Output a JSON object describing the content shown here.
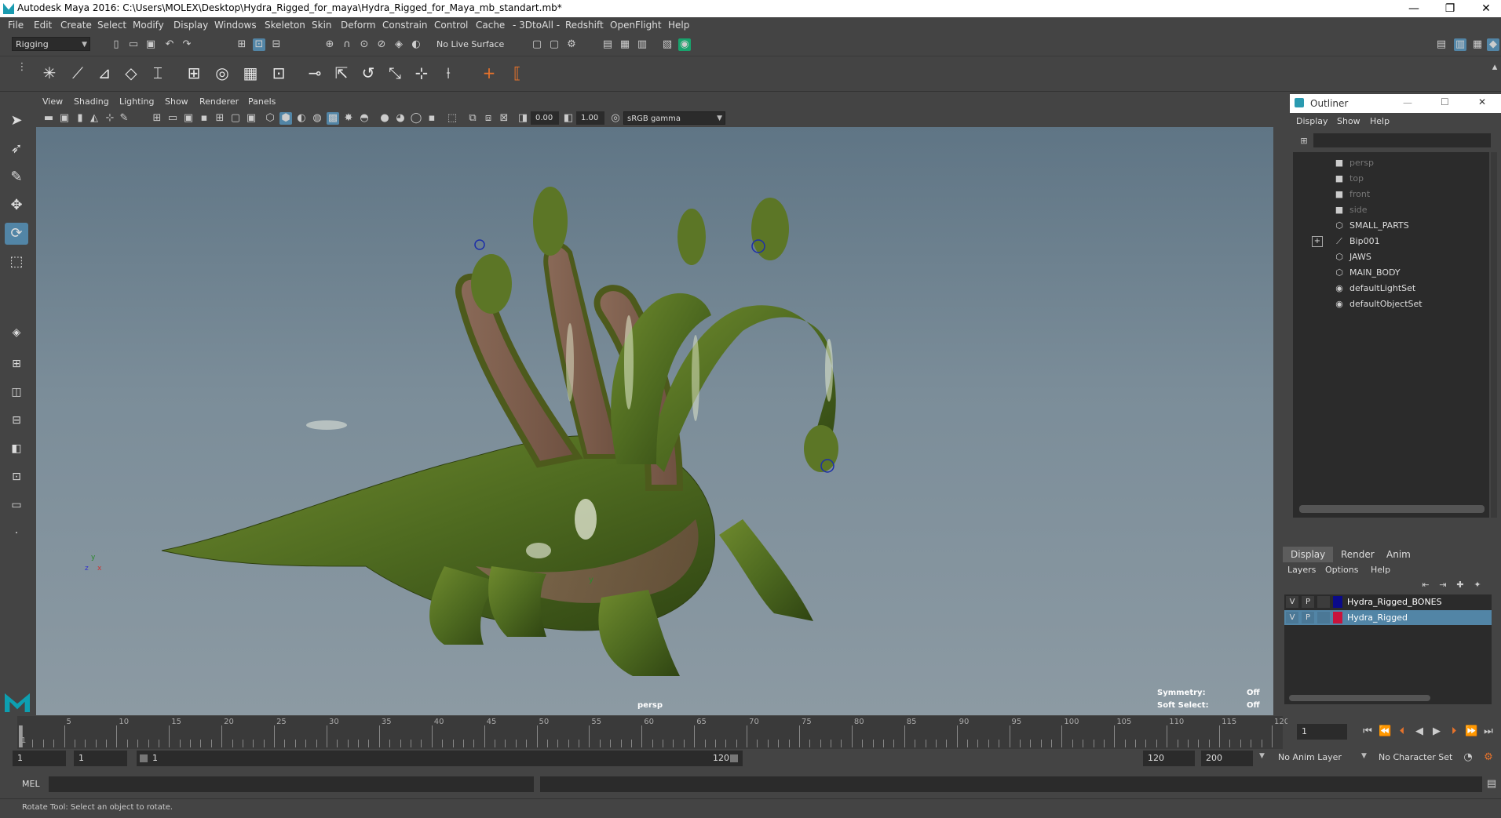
{
  "window": {
    "title": "Autodesk Maya 2016: C:\\Users\\MOLEX\\Desktop\\Hydra_Rigged_for_maya\\Hydra_Rigged_for_Maya_mb_standart.mb*",
    "minimize": "—",
    "restore": "❐",
    "close": "✕"
  },
  "menubar": [
    "File",
    "Edit",
    "Create",
    "Select",
    "Modify",
    "Display",
    "Windows",
    "Skeleton",
    "Skin",
    "Deform",
    "Constrain",
    "Control",
    "Cache",
    "- 3DtoAll -",
    "Redshift",
    "OpenFlight",
    "Help"
  ],
  "statusline": {
    "menuset": "Rigging",
    "live_surface": "No Live Surface"
  },
  "viewport": {
    "menus": [
      "View",
      "Shading",
      "Lighting",
      "Show",
      "Renderer",
      "Panels"
    ],
    "exposure": "0.00",
    "gamma": "1.00",
    "colorspace": "sRGB gamma",
    "camera_label": "persp",
    "hud": {
      "symmetry_label": "Symmetry:",
      "symmetry_value": "Off",
      "softselect_label": "Soft Select:",
      "softselect_value": "Off"
    },
    "axis": {
      "x": "x",
      "y": "y",
      "z": "z"
    }
  },
  "outliner": {
    "title": "Outliner",
    "menus": [
      "Display",
      "Show",
      "Help"
    ],
    "items": [
      {
        "label": "persp",
        "icon": "camera-icon",
        "dim": true
      },
      {
        "label": "top",
        "icon": "camera-icon",
        "dim": true
      },
      {
        "label": "front",
        "icon": "camera-icon",
        "dim": true
      },
      {
        "label": "side",
        "icon": "camera-icon",
        "dim": true
      },
      {
        "label": "SMALL_PARTS",
        "icon": "mesh-icon",
        "dim": false
      },
      {
        "label": "Bip001",
        "icon": "joint-icon",
        "dim": false,
        "expandable": true
      },
      {
        "label": "JAWS",
        "icon": "mesh-icon",
        "dim": false
      },
      {
        "label": "MAIN_BODY",
        "icon": "mesh-icon",
        "dim": false
      },
      {
        "label": "defaultLightSet",
        "icon": "set-icon",
        "dim": false
      },
      {
        "label": "defaultObjectSet",
        "icon": "set-icon",
        "dim": false
      }
    ]
  },
  "layers": {
    "tabs": [
      "Display",
      "Render",
      "Anim"
    ],
    "menus": [
      "Layers",
      "Options",
      "Help"
    ],
    "rows": [
      {
        "v": "V",
        "p": "P",
        "name": "Hydra_Rigged_BONES",
        "color": "#0a0a8a",
        "selected": false
      },
      {
        "v": "V",
        "p": "P",
        "name": "Hydra_Rigged",
        "color": "#c8143c",
        "selected": true
      }
    ]
  },
  "timeslider": {
    "labels": [
      "1",
      "5",
      "10",
      "15",
      "20",
      "25",
      "30",
      "35",
      "40",
      "45",
      "50",
      "55",
      "60",
      "65",
      "70",
      "75",
      "80",
      "85",
      "90",
      "95",
      "100",
      "105",
      "110",
      "115",
      "120"
    ],
    "current_frame": "1"
  },
  "range": {
    "start": "1",
    "playback_start": "1",
    "slider_start": "1",
    "slider_end": "120",
    "playback_end": "120",
    "end": "200",
    "anim_layer": "No Anim Layer",
    "character_set": "No Character Set"
  },
  "cmdline": {
    "label": "MEL"
  },
  "helpline": {
    "text": "Rotate Tool: Select an object to rotate."
  }
}
